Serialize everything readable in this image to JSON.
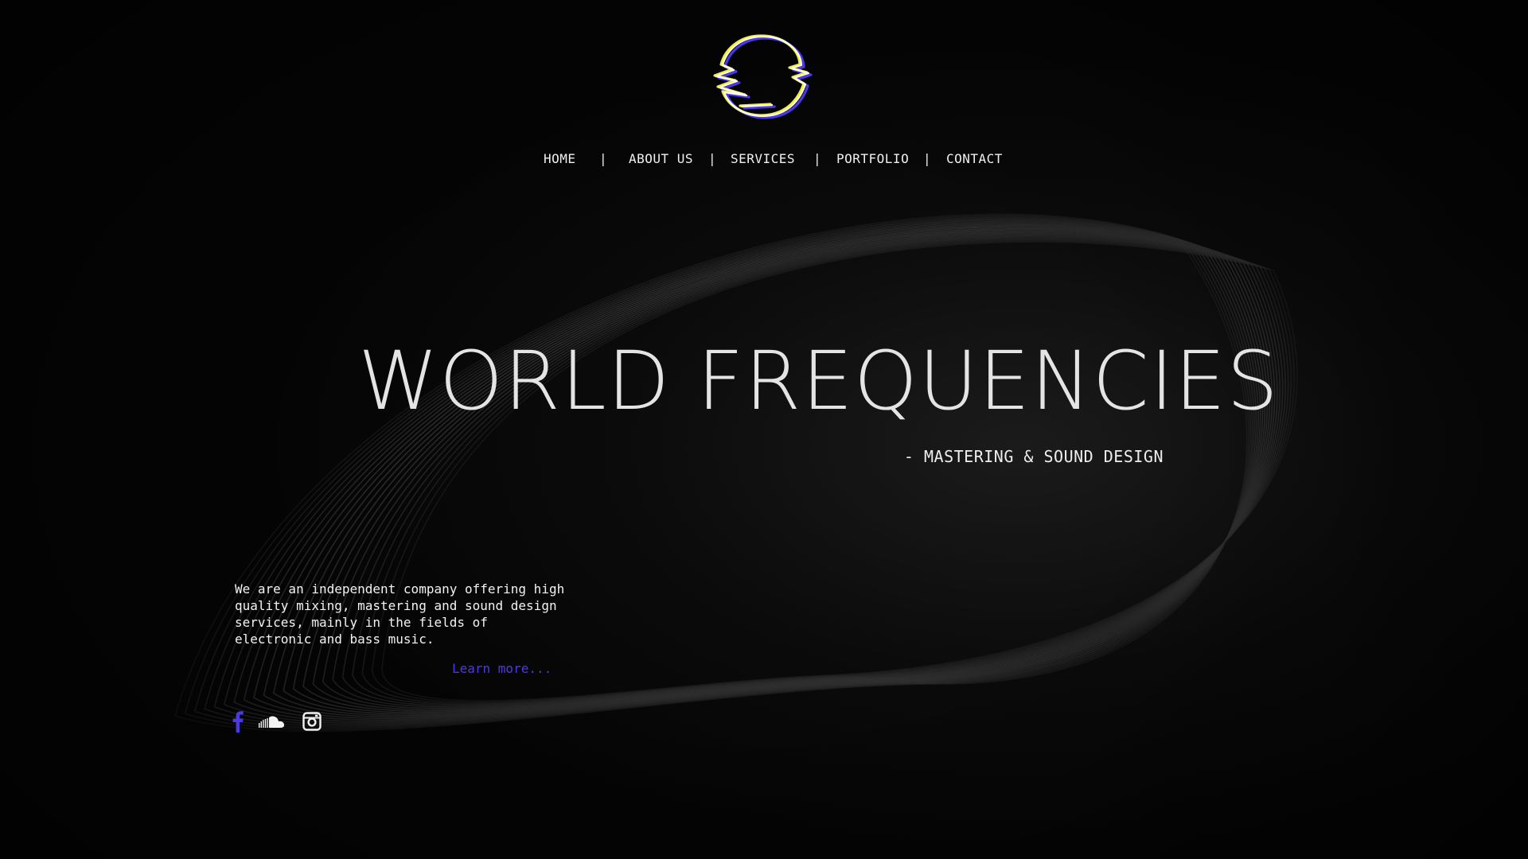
{
  "brand": {
    "logo_icon": "glitch-circle-logo",
    "accent_colors": [
      "#f2ef3a",
      "#4b39e6",
      "#ffffff"
    ]
  },
  "nav": {
    "items": [
      {
        "label": "HOME"
      },
      {
        "label": "ABOUT US"
      },
      {
        "label": "SERVICES"
      },
      {
        "label": "PORTFOLIO"
      },
      {
        "label": "CONTACT"
      }
    ],
    "separator": "|"
  },
  "hero": {
    "title": "WORLD FREQUENCIES",
    "subtitle": "- MASTERING & SOUND DESIGN"
  },
  "intro": {
    "text": "We are an independent company offering high quality mixing, mastering and sound design services, mainly in the fields of electronic and bass music.",
    "link_label": "Learn more...",
    "link_color": "#4b39e6"
  },
  "social": {
    "icons": [
      "facebook-icon",
      "soundcloud-icon",
      "instagram-icon"
    ],
    "facebook_color": "#4b39e6"
  },
  "colors": {
    "background": "#050505",
    "text": "#e9e9e9"
  }
}
